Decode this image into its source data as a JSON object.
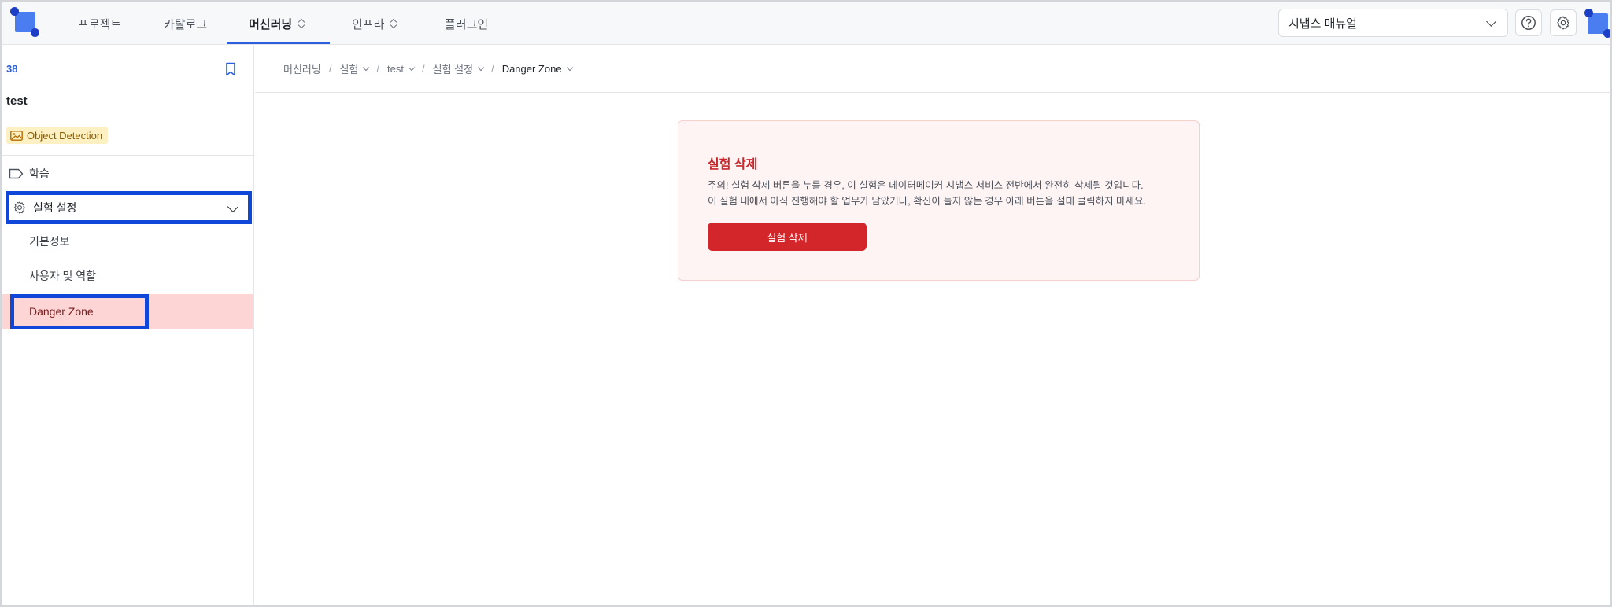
{
  "nav": {
    "items": [
      {
        "label": "프로젝트"
      },
      {
        "label": "카탈로그"
      },
      {
        "label": "머신러닝"
      },
      {
        "label": "인프라"
      },
      {
        "label": "플러그인"
      }
    ],
    "manual_select_value": "시냅스 매뉴얼"
  },
  "sidebar": {
    "experiment_number": "38",
    "experiment_name": "test",
    "tag": "Object Detection",
    "menu": {
      "train_label": "학습",
      "settings_label": "실험 설정",
      "sub_items": [
        {
          "label": "기본정보"
        },
        {
          "label": "사용자 및 역할"
        },
        {
          "label": "Danger Zone"
        }
      ]
    }
  },
  "breadcrumb": [
    {
      "label": "머신러닝"
    },
    {
      "label": "실험"
    },
    {
      "label": "test"
    },
    {
      "label": "실험 설정"
    },
    {
      "label": "Danger Zone"
    }
  ],
  "danger_card": {
    "title": "실험 삭제",
    "desc_line1": "주의! 실험 삭제 버튼을 누를 경우, 이 실험은 데이터메이커 시냅스 서비스 전반에서 완전히 삭제될 것입니다.",
    "desc_line2": "이 실험 내에서 아직 진행해야 할 업무가 남았거나, 확신이 들지 않는 경우 아래 버튼을 절대 클릭하지 마세요.",
    "button_label": "실험 삭제"
  },
  "colors": {
    "accent": "#2c5fe0",
    "danger": "#d3262b",
    "highlight_outline": "#0f48d8"
  }
}
